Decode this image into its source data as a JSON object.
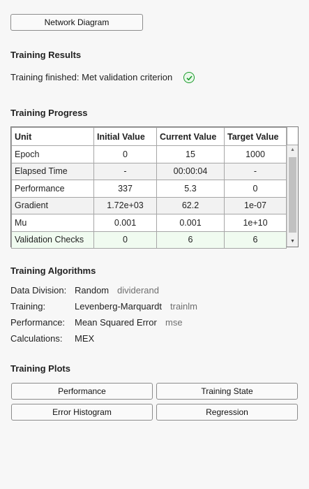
{
  "network_diagram_button": "Network Diagram",
  "results": {
    "heading": "Training Results",
    "status": "Training finished: Met validation criterion"
  },
  "progress": {
    "heading": "Training Progress",
    "columns": [
      "Unit",
      "Initial Value",
      "Current Value",
      "Target Value"
    ],
    "rows": [
      {
        "unit": "Epoch",
        "initial": "0",
        "current": "15",
        "target": "1000"
      },
      {
        "unit": "Elapsed Time",
        "initial": "-",
        "current": "00:00:04",
        "target": "-"
      },
      {
        "unit": "Performance",
        "initial": "337",
        "current": "5.3",
        "target": "0"
      },
      {
        "unit": "Gradient",
        "initial": "1.72e+03",
        "current": "62.2",
        "target": "1e-07"
      },
      {
        "unit": "Mu",
        "initial": "0.001",
        "current": "0.001",
        "target": "1e+10"
      },
      {
        "unit": "Validation Checks",
        "initial": "0",
        "current": "6",
        "target": "6"
      }
    ]
  },
  "algorithms": {
    "heading": "Training Algorithms",
    "items": [
      {
        "label": "Data Division:",
        "value": "Random",
        "func": "dividerand"
      },
      {
        "label": "Training:",
        "value": "Levenberg-Marquardt",
        "func": "trainlm"
      },
      {
        "label": "Performance:",
        "value": "Mean Squared Error",
        "func": "mse"
      },
      {
        "label": "Calculations:",
        "value": "MEX",
        "func": ""
      }
    ]
  },
  "plots": {
    "heading": "Training Plots",
    "buttons": [
      "Performance",
      "Training State",
      "Error Histogram",
      "Regression"
    ]
  },
  "colors": {
    "success": "#1a9b2a",
    "highlight_row": "#f0fbf0"
  }
}
